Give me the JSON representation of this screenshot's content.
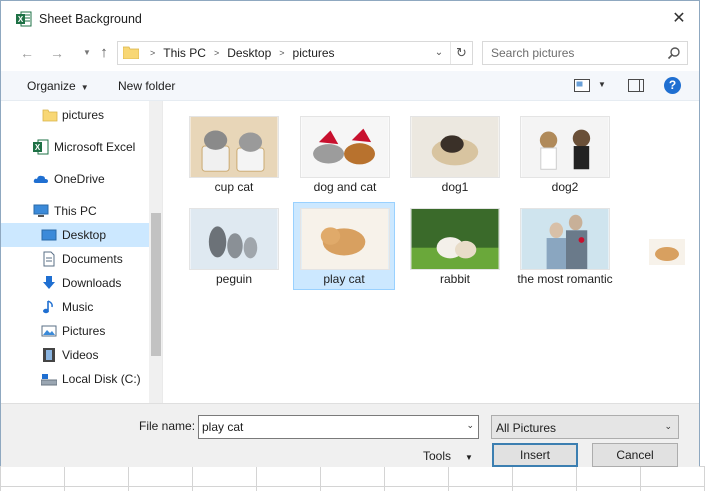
{
  "window": {
    "title": "Sheet Background"
  },
  "navigation": {
    "breadcrumbs": [
      "This PC",
      "Desktop",
      "pictures"
    ],
    "search_placeholder": "Search pictures"
  },
  "toolbar": {
    "organize": "Organize",
    "new_folder": "New folder",
    "help": "?"
  },
  "sidebar": {
    "items": [
      {
        "label": "pictures",
        "icon": "folder-icon"
      },
      {
        "label": "Microsoft Excel",
        "icon": "excel-icon"
      },
      {
        "label": "OneDrive",
        "icon": "cloud-icon"
      },
      {
        "label": "This PC",
        "icon": "computer-icon"
      },
      {
        "label": "Desktop",
        "icon": "desktop-icon",
        "selected": true
      },
      {
        "label": "Documents",
        "icon": "documents-icon"
      },
      {
        "label": "Downloads",
        "icon": "downloads-icon"
      },
      {
        "label": "Music",
        "icon": "music-icon"
      },
      {
        "label": "Pictures",
        "icon": "pictures-icon"
      },
      {
        "label": "Videos",
        "icon": "videos-icon"
      },
      {
        "label": "Local Disk (C:)",
        "icon": "disk-icon"
      }
    ]
  },
  "files": [
    {
      "name": "cup cat"
    },
    {
      "name": "dog and cat"
    },
    {
      "name": "dog1"
    },
    {
      "name": "dog2"
    },
    {
      "name": "peguin"
    },
    {
      "name": "play cat",
      "selected": true
    },
    {
      "name": "rabbit"
    },
    {
      "name": "the most romantic"
    }
  ],
  "footer": {
    "file_name_label": "File name:",
    "file_name_value": "play cat",
    "file_type": "All Pictures",
    "tools": "Tools",
    "insert": "Insert",
    "cancel": "Cancel"
  },
  "colors": {
    "selection": "#cce8ff",
    "help": "#1f6fd1",
    "excel_green": "#1e7145"
  }
}
